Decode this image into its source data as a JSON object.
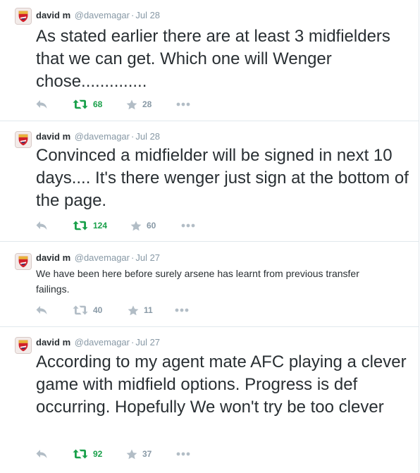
{
  "tweets": [
    {
      "name": "david m",
      "handle": "@davemagar",
      "date": "Jul 28",
      "text": "As stated earlier there are at least 3 midfielders that we can get. Which one will Wenger chose..............",
      "retweets": "68",
      "favorites": "28"
    },
    {
      "name": "david m",
      "handle": "@davemagar",
      "date": "Jul 28",
      "text": "Convinced a midfielder will be signed in next 10 days.... It's there wenger just sign at the bottom of the page.",
      "retweets": "124",
      "favorites": "60"
    },
    {
      "name": "david m",
      "handle": "@davemagar",
      "date": "Jul 27",
      "text": "We have been here before surely arsene has learnt from previous transfer failings.",
      "retweets": "40",
      "favorites": "11"
    },
    {
      "name": "david m",
      "handle": "@davemagar",
      "date": "Jul 27",
      "text": "According to my agent mate AFC playing a clever game with midfield options. Progress is def occurring. Hopefully We won't try be too clever",
      "retweets": "92",
      "favorites": "37"
    }
  ],
  "separator": "·",
  "icons": {
    "reply": "reply-icon",
    "retweet": "retweet-icon",
    "favorite": "star-icon",
    "more": "more-icon",
    "avatar": "arsenal-crest-icon"
  },
  "colors": {
    "retweet_active": "#19a04a",
    "muted": "#8899a6",
    "text": "#292f33",
    "border": "#e1e8ed"
  }
}
